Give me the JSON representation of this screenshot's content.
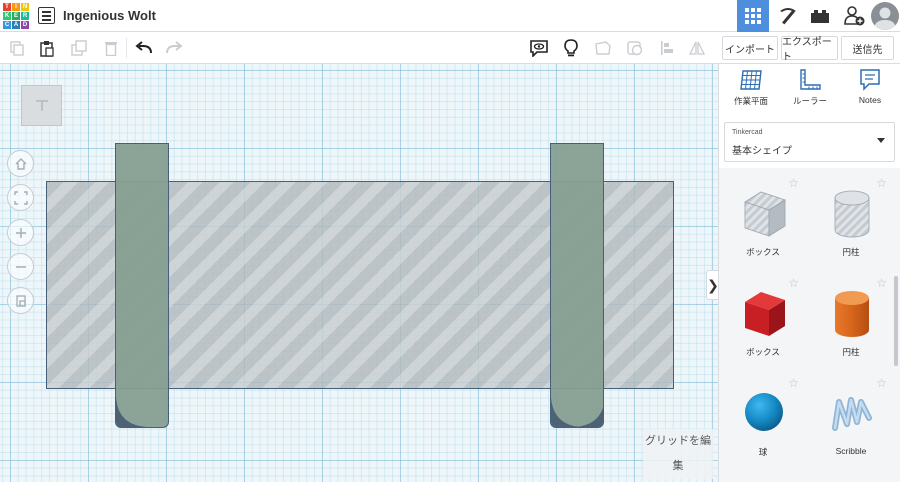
{
  "app": {
    "logo_letters": [
      "T",
      "I",
      "N",
      "K",
      "E",
      "R",
      "C",
      "A",
      "D"
    ],
    "logo_colors": [
      "#e8412d",
      "#f39c12",
      "#f1c40f",
      "#2ecc71",
      "#27ae60",
      "#1abc9c",
      "#3498db",
      "#2980b9",
      "#8e44ad"
    ],
    "design_title": "Ingenious Wolt"
  },
  "header": {
    "active_view_color": "#4d8fdc",
    "buttons": [
      "3d-design-view-icon",
      "pickaxe-icon",
      "bricks-icon",
      "add-user-icon",
      "user-avatar"
    ]
  },
  "toolbar": {
    "left_icons": [
      "copy-icon",
      "paste-icon",
      "duplicate-icon",
      "delete-icon",
      "undo-icon",
      "redo-icon"
    ],
    "right_icons": [
      "notes-visibility-icon",
      "lightbulb-icon",
      "shape-solid-icon",
      "shape-hole-icon",
      "align-icon",
      "mirror-icon"
    ],
    "import_label": "インポート",
    "export_label": "エクスポート",
    "send_label": "送信先"
  },
  "workplane": {
    "viewcube_label": "T",
    "edit_grid_label_1": "グリッドを編",
    "edit_grid_label_2": "集",
    "collapse_label": "❯"
  },
  "panel": {
    "tools": [
      {
        "label": "作業平面",
        "icon": "workplane-icon"
      },
      {
        "label": "ルーラー",
        "icon": "ruler-icon"
      },
      {
        "label": "Notes",
        "icon": "notes-icon"
      }
    ],
    "library_category": "Tinkercad",
    "library_selected": "基本シェイプ",
    "shapes": [
      {
        "label": "ボックス",
        "icon": "box-hole-icon"
      },
      {
        "label": "円柱",
        "icon": "cylinder-hole-icon"
      },
      {
        "label": "ボックス",
        "icon": "box-icon"
      },
      {
        "label": "円柱",
        "icon": "cylinder-icon"
      },
      {
        "label": "球",
        "icon": "sphere-icon"
      },
      {
        "label": "Scribble",
        "icon": "scribble-icon"
      }
    ]
  }
}
